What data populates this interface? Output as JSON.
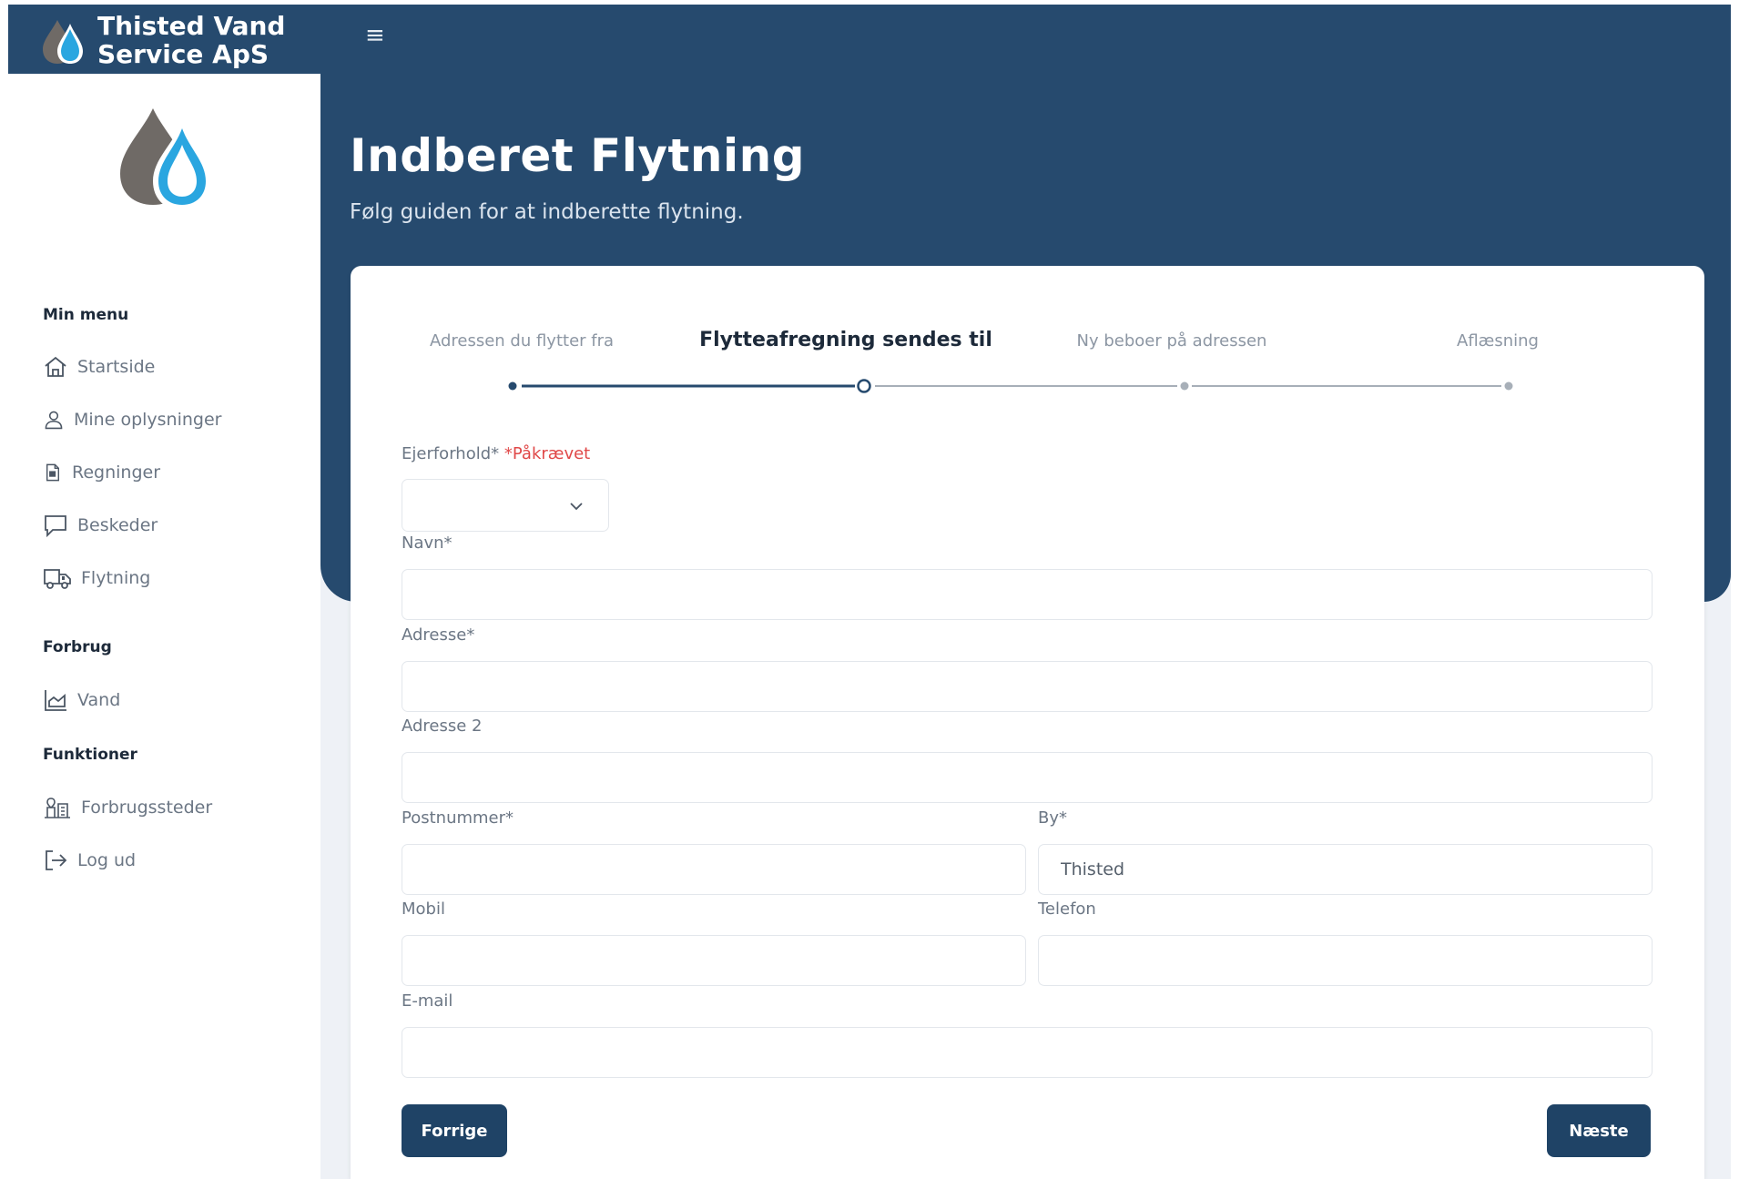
{
  "app": {
    "brand_line1": "Thisted Vand",
    "brand_line2": "Service ApS"
  },
  "colors": {
    "primary": "#264a6e",
    "button": "#1f4366",
    "required": "#e04848",
    "drop_gray": "#6f6a66",
    "drop_blue": "#2aa6e0"
  },
  "sidebar": {
    "sections": [
      {
        "title": "Min menu",
        "items": [
          {
            "label": "Startside",
            "icon": "home-icon"
          },
          {
            "label": "Mine oplysninger",
            "icon": "user-icon"
          },
          {
            "label": "Regninger",
            "icon": "invoice-icon"
          },
          {
            "label": "Beskeder",
            "icon": "message-icon"
          },
          {
            "label": "Flytning",
            "icon": "truck-icon"
          }
        ]
      },
      {
        "title": "Forbrug",
        "items": [
          {
            "label": "Vand",
            "icon": "chart-icon"
          }
        ]
      },
      {
        "title": "Funktioner",
        "items": [
          {
            "label": "Forbrugssteder",
            "icon": "location-building-icon"
          },
          {
            "label": "Log ud",
            "icon": "logout-icon"
          }
        ]
      }
    ]
  },
  "page": {
    "title": "Indberet Flytning",
    "subtitle": "Følg guiden for at indberette flytning."
  },
  "wizard": {
    "steps": [
      {
        "label": "Adressen du flytter fra",
        "state": "done"
      },
      {
        "label": "Flytteafregning sendes til",
        "state": "active"
      },
      {
        "label": "Ny beboer på adressen",
        "state": "pending"
      },
      {
        "label": "Aflæsning",
        "state": "pending"
      }
    ]
  },
  "form": {
    "ejerforhold_label": "Ejerforhold*",
    "required_note": "*Påkrævet",
    "ejerforhold_value": "",
    "navn_label": "Navn*",
    "navn_value": "",
    "adresse_label": "Adresse*",
    "adresse_value": "",
    "adresse2_label": "Adresse 2",
    "adresse2_value": "",
    "postnummer_label": "Postnummer*",
    "postnummer_value": "",
    "by_label": "By*",
    "by_value": "Thisted",
    "mobil_label": "Mobil",
    "mobil_value": "",
    "telefon_label": "Telefon",
    "telefon_value": "",
    "email_label": "E-mail",
    "email_value": ""
  },
  "buttons": {
    "prev": "Forrige",
    "next": "Næste"
  }
}
